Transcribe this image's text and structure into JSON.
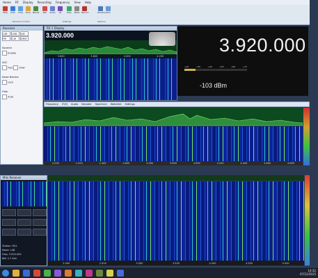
{
  "menu": [
    "Home",
    "RF",
    "Display",
    "Recording",
    "Frequency",
    "View",
    "Help"
  ],
  "ribbon_groups": [
    "Receiver Control",
    "Settings",
    "Options"
  ],
  "ribbon_buttons": [
    "Stop",
    "Scan",
    "Freq",
    "Tune",
    "Bands",
    "Rec",
    "Audio",
    "IQ",
    "Play",
    "Mute",
    "Record",
    "Window",
    "Skin"
  ],
  "main_freq": "3.920.000",
  "mini_freq": "3.920.000",
  "signal_level": "-103 dBm",
  "meter_scale": [
    "+20",
    "+30",
    "+40",
    "+50",
    "+60",
    "+70"
  ],
  "left_panel": {
    "title": "Receiver",
    "rows": [
      "LSB",
      "USB",
      "AM",
      "FM",
      "CW",
      "DRM"
    ],
    "labels": [
      "Squelch",
      "AGC",
      "Noise Blanker",
      "Filter"
    ],
    "options": [
      "Enable",
      "Lock",
      "Auto",
      "Fast",
      "Slow"
    ]
  },
  "right_title": "RX 1 Display",
  "spectrum_top_ticks": [
    "3.600",
    "3.800",
    "4.000",
    "4.200"
  ],
  "wide_ticks": [
    "2.000",
    "2.200",
    "2.400",
    "2.600",
    "3.000",
    "3.800",
    "4.000",
    "4.200",
    "4.400",
    "4.600",
    "4.800"
  ],
  "bottom_ticks": [
    "2.000",
    "2.500",
    "3.000",
    "3.500",
    "4.000",
    "4.500",
    "5.000"
  ],
  "mid_tabs": [
    "Frequency",
    "IF/IQ",
    "Audio",
    "Decoder",
    "Spectrum",
    "Waterfall",
    "Settings"
  ],
  "lower_left": {
    "title": "Mini Receiver",
    "info": [
      "Station: RX1",
      "Mode: LSB",
      "Freq: 3.920.000",
      "BW: 2.7 kHz"
    ]
  },
  "clock": {
    "time": "14:32",
    "date": "07/12/2015"
  },
  "colors": {
    "accent": "#2a6bd4",
    "waterfall": "#0a1e8c",
    "signal": "#3fe08a"
  }
}
